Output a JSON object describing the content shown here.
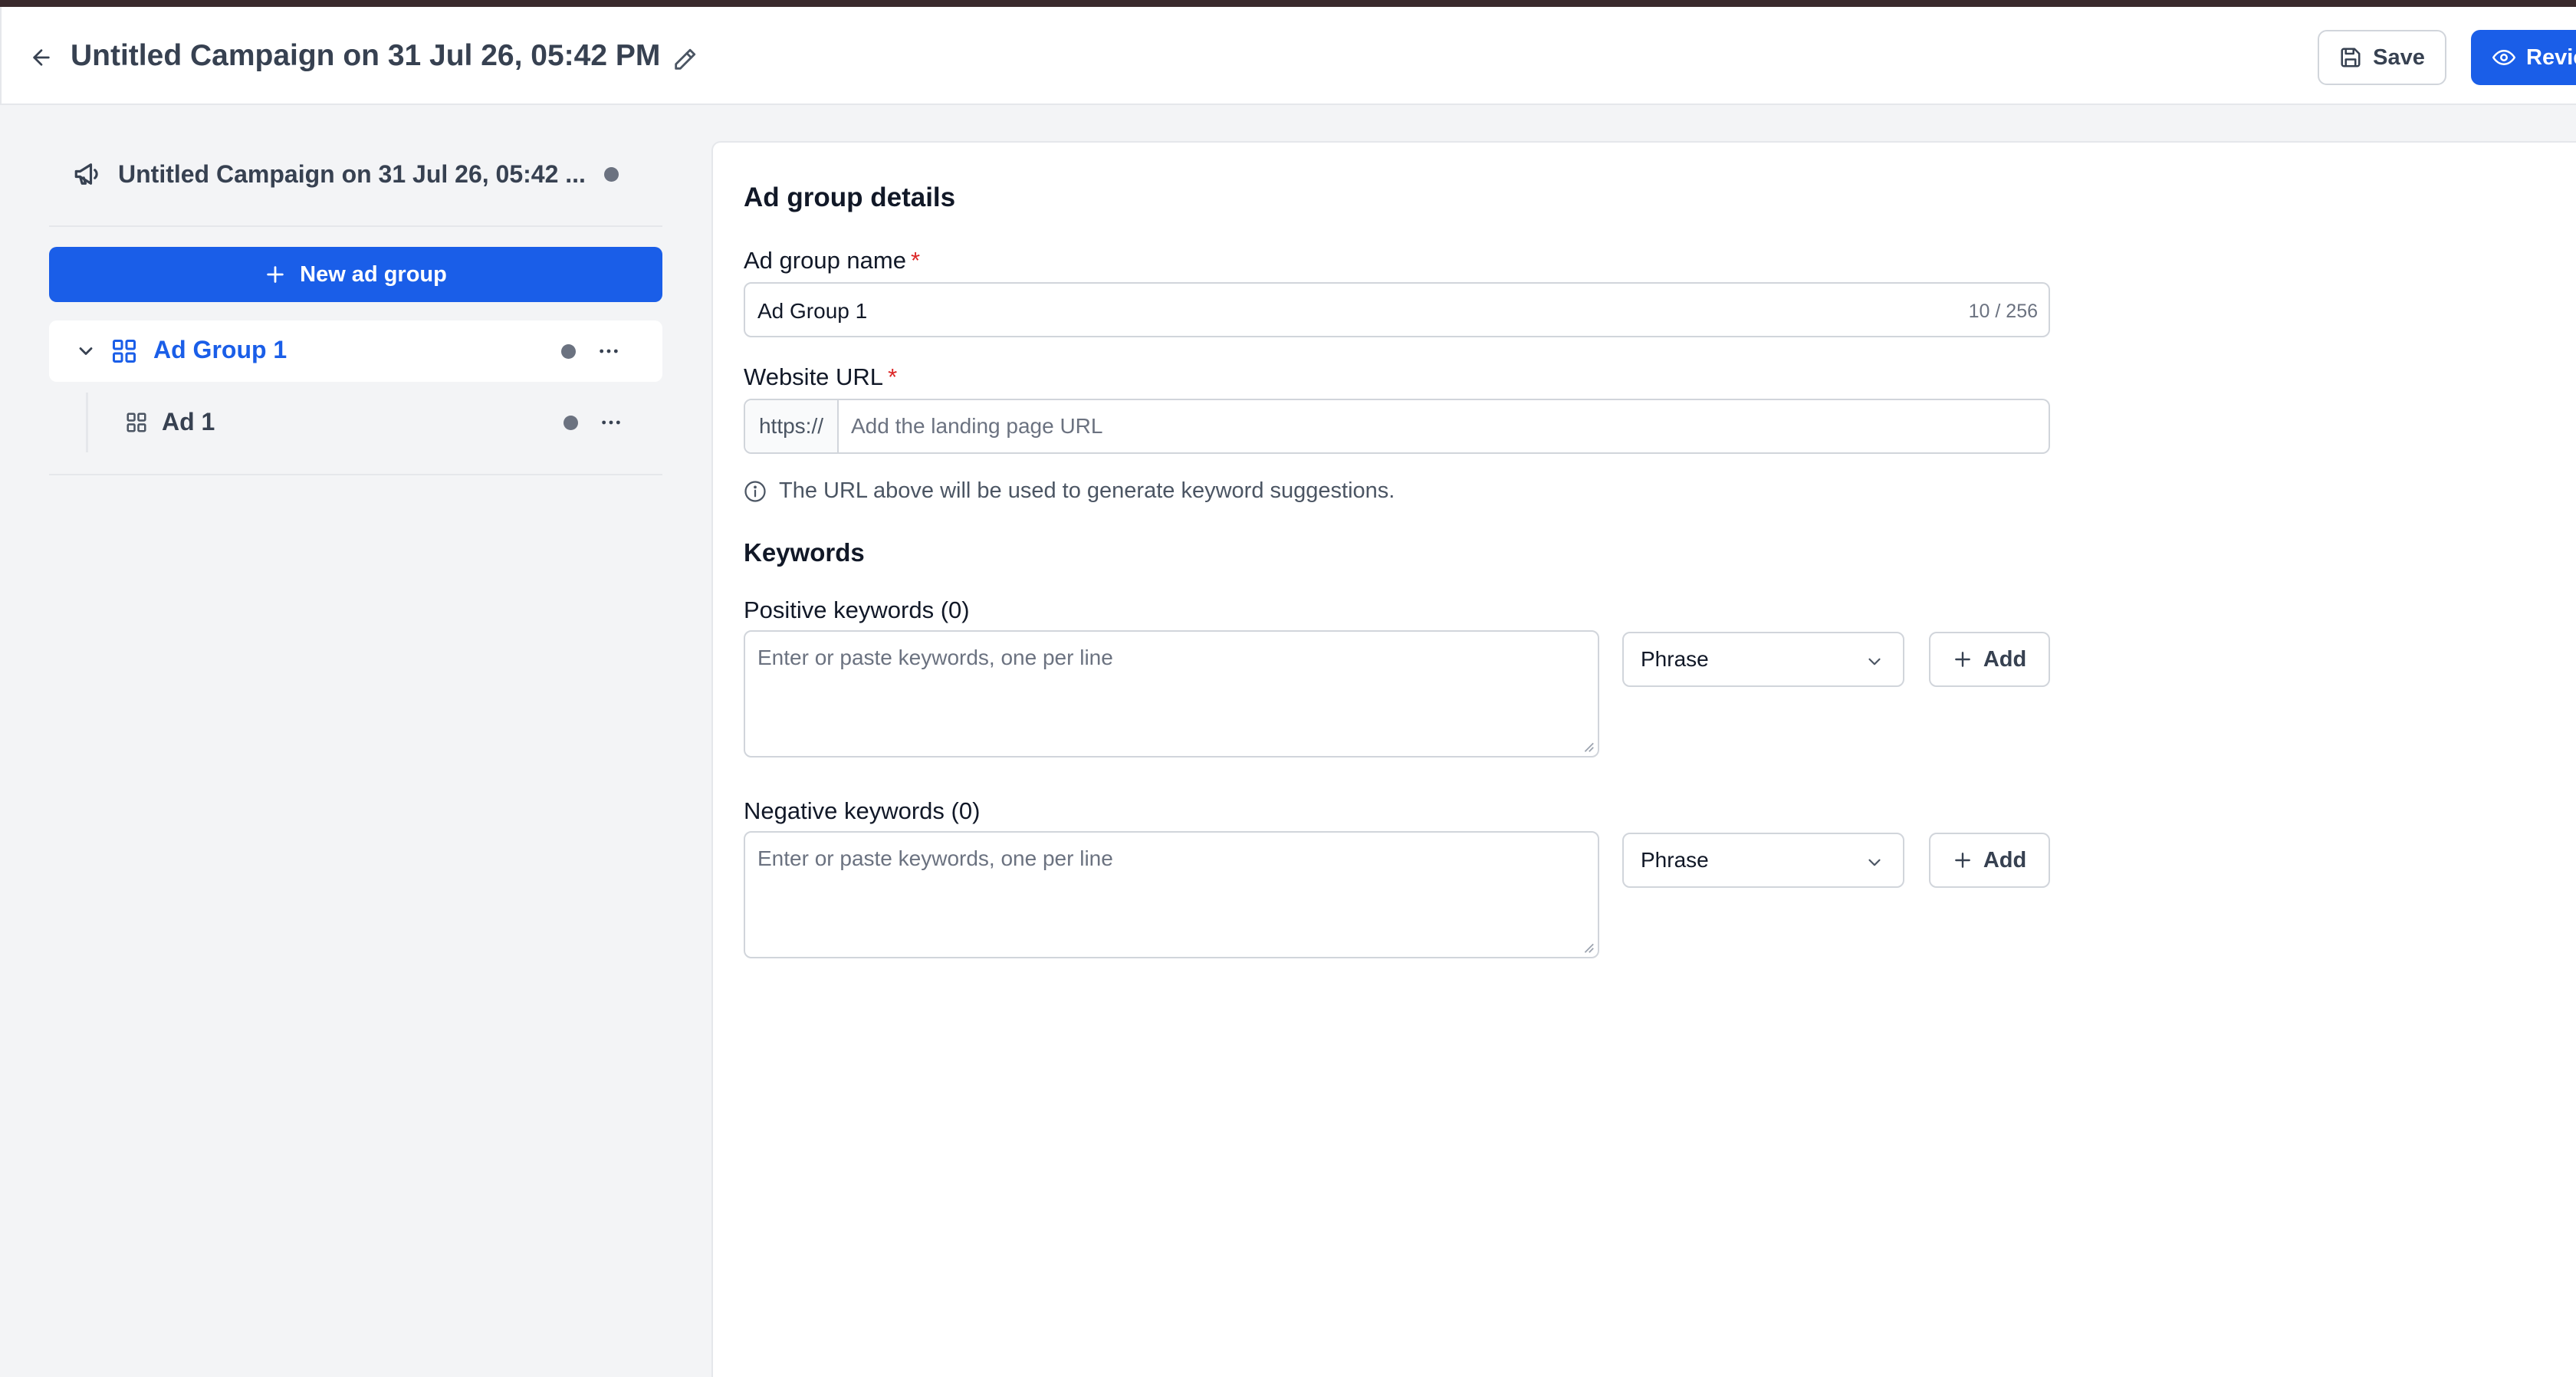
{
  "header": {
    "title": "Untitled Campaign on 31 Jul 26, 05:42 PM",
    "save_label": "Save",
    "review_label": "Review"
  },
  "sidebar": {
    "campaign_name": "Untitled Campaign on 31 Jul 26, 05:42 ...",
    "new_group_label": "New ad group",
    "groups": [
      {
        "label": "Ad Group 1",
        "ads": [
          {
            "label": "Ad 1"
          }
        ]
      }
    ]
  },
  "form": {
    "section_title": "Ad group details",
    "name_label": "Ad group name",
    "required_mark": "*",
    "name_value": "Ad Group 1",
    "name_count": "10 / 256",
    "url_label": "Website URL",
    "url_prefix": "https://",
    "url_placeholder": "Add the landing page URL",
    "url_hint": "The URL above will be used to generate keyword suggestions.",
    "keywords_title": "Keywords",
    "positive_label": "Positive keywords (0)",
    "negative_label": "Negative keywords (0)",
    "keywords_placeholder": "Enter or paste keywords, one per line",
    "match_type": "Phrase",
    "add_label": "Add"
  },
  "colors": {
    "primary": "#1a5ee8",
    "required": "#dc2626",
    "status_dot": "#6b7280"
  }
}
